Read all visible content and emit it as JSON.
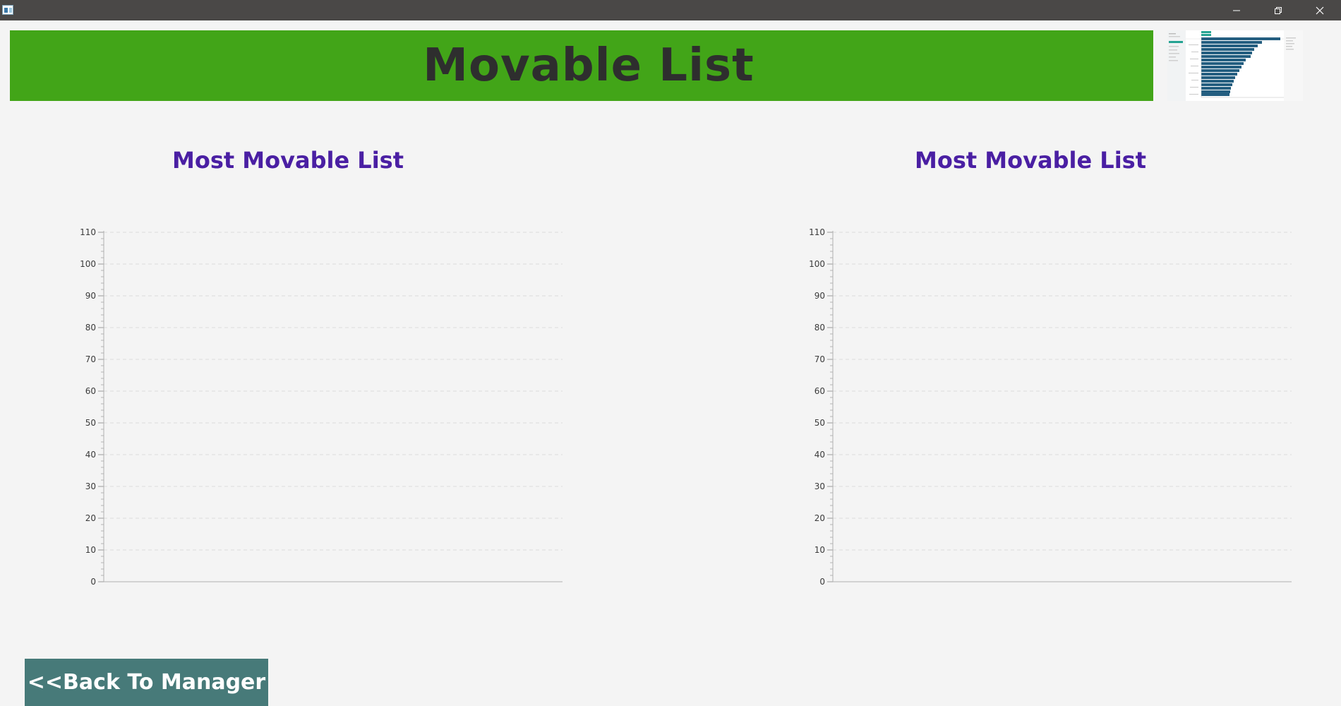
{
  "window": {
    "controls": {
      "minimize_icon": "minimize-icon",
      "maximize_icon": "restore-icon",
      "close_icon": "close-icon"
    }
  },
  "header": {
    "title": "Movable List",
    "background_color": "#42a518",
    "text_color": "#2e2e2e"
  },
  "preview": {
    "description_icon": "thumbnail-preview"
  },
  "charts": {
    "left_title": "Most Movable List",
    "right_title": "Most Movable List",
    "title_color": "#4a1fa3"
  },
  "chart_data": [
    {
      "type": "bar",
      "title": "Most Movable List",
      "categories": [],
      "values": [],
      "ylim": [
        0,
        110
      ],
      "y_ticks": [
        "0",
        "10",
        "20",
        "30",
        "40",
        "50",
        "60",
        "70",
        "80",
        "90",
        "100",
        "110"
      ],
      "grid": true
    },
    {
      "type": "bar",
      "title": "Most Movable List",
      "categories": [],
      "values": [],
      "ylim": [
        0,
        110
      ],
      "y_ticks": [
        "0",
        "10",
        "20",
        "30",
        "40",
        "50",
        "60",
        "70",
        "80",
        "90",
        "100",
        "110"
      ],
      "grid": true
    }
  ],
  "footer": {
    "back_button_label": "<<Back To Manager",
    "back_button_color": "#477a79"
  }
}
